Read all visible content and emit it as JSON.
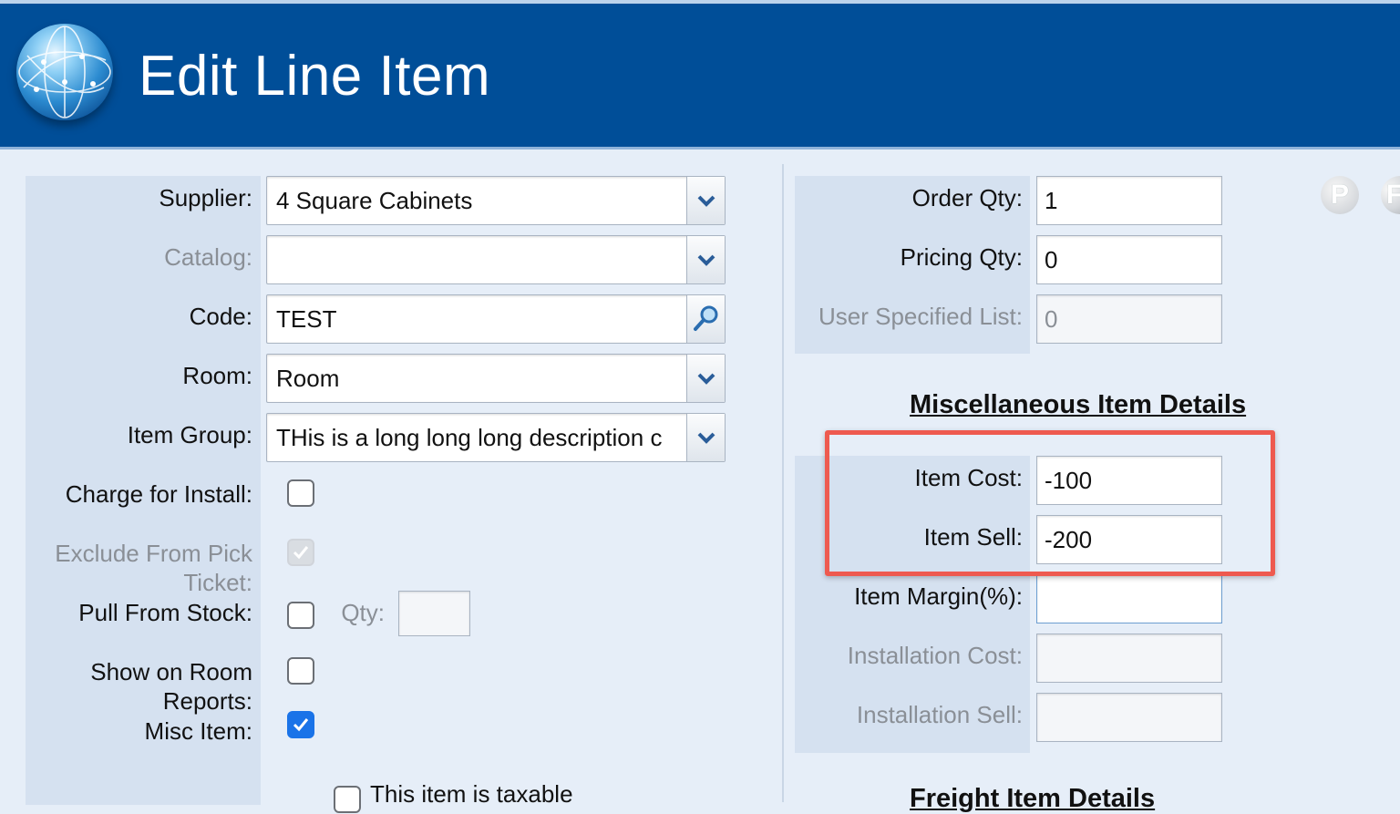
{
  "header": {
    "title": "Edit Line Item"
  },
  "left_form": {
    "supplier": {
      "label": "Supplier:",
      "value": "4 Square Cabinets"
    },
    "catalog": {
      "label": "Catalog:",
      "value": ""
    },
    "code": {
      "label": "Code:",
      "value": "TEST"
    },
    "room": {
      "label": "Room:",
      "value": "Room"
    },
    "item_group": {
      "label": "Item Group:",
      "value": "THis is a long long long description c"
    },
    "charge_install": {
      "label": "Charge for Install:",
      "checked": false
    },
    "exclude_pick": {
      "label_line1": "Exclude From Pick",
      "label_line2": "Ticket:",
      "checked": true
    },
    "pull_stock": {
      "label": "Pull From Stock:",
      "checked": false,
      "qty_label": "Qty:",
      "qty_value": ""
    },
    "show_room": {
      "label_line1": "Show on Room",
      "label_line2": "Reports:",
      "checked": false
    },
    "misc_item": {
      "label": "Misc Item:",
      "checked": true
    },
    "taxable": {
      "label": "This item is taxable",
      "checked": false
    }
  },
  "right_form": {
    "order_qty": {
      "label": "Order Qty:",
      "value": "1"
    },
    "pricing_qty": {
      "label": "Pricing Qty:",
      "value": "0"
    },
    "user_list": {
      "label": "User Specified List:",
      "value": "0"
    },
    "misc_section_title": "Miscellaneous Item Details",
    "item_cost": {
      "label": "Item Cost:",
      "value": "-100"
    },
    "item_sell": {
      "label": "Item Sell:",
      "value": "-200"
    },
    "item_margin": {
      "label": "Item Margin(%):",
      "value": ""
    },
    "install_cost": {
      "label": "Installation Cost:",
      "value": ""
    },
    "install_sell": {
      "label": "Installation Sell:",
      "value": ""
    },
    "freight_section_title": "Freight Item Details"
  },
  "icons": {
    "p_icon_letter": "P",
    "f_icon_letter": "F"
  },
  "colors": {
    "header_bg": "#004e98",
    "panel_bg": "#d5e1f0",
    "highlight": "#ee5a4f",
    "checkbox_checked": "#1a73e8"
  }
}
